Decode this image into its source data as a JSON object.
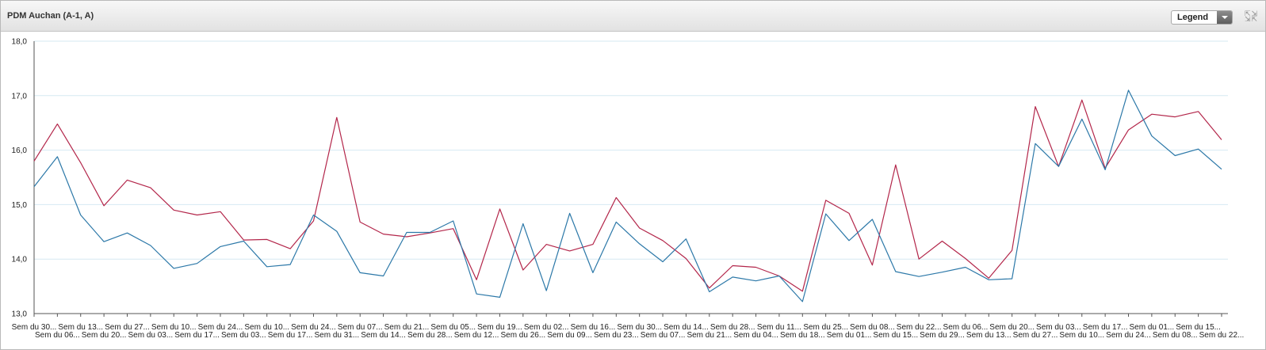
{
  "header": {
    "title": "PDM Auchan (A-1, A)",
    "legend_label": "Legend",
    "expand_icon": "expand-icon"
  },
  "colors": {
    "series_a": "#b3264a",
    "series_b": "#2c78a8",
    "grid": "#d6e9f2",
    "axis": "#555555"
  },
  "chart_data": {
    "type": "line",
    "title": "PDM Auchan (A-1, A)",
    "xlabel": "",
    "ylabel": "",
    "ylim": [
      13.0,
      18.0
    ],
    "yticks": [
      "13,0",
      "14,0",
      "15,0",
      "16,0",
      "17,0",
      "18,0"
    ],
    "ytick_values": [
      13.0,
      14.0,
      15.0,
      16.0,
      17.0,
      18.0
    ],
    "grid": true,
    "legend": "collapsed dropdown (top-right)",
    "categories": [
      "Sem du 30...",
      "Sem du 06...",
      "Sem du 13...",
      "Sem du 20...",
      "Sem du 27...",
      "Sem du 03...",
      "Sem du 10...",
      "Sem du 17...",
      "Sem du 24...",
      "Sem du 03...",
      "Sem du 10...",
      "Sem du 17...",
      "Sem du 24...",
      "Sem du 31...",
      "Sem du 07...",
      "Sem du 14...",
      "Sem du 21...",
      "Sem du 28...",
      "Sem du 05...",
      "Sem du 12...",
      "Sem du 19...",
      "Sem du 26...",
      "Sem du 02...",
      "Sem du 09...",
      "Sem du 16...",
      "Sem du 23...",
      "Sem du 30...",
      "Sem du 07...",
      "Sem du 14...",
      "Sem du 21...",
      "Sem du 28...",
      "Sem du 04...",
      "Sem du 11...",
      "Sem du 18...",
      "Sem du 25...",
      "Sem du 01...",
      "Sem du 08...",
      "Sem du 15...",
      "Sem du 22...",
      "Sem du 29...",
      "Sem du 06...",
      "Sem du 13...",
      "Sem du 20...",
      "Sem du 27...",
      "Sem du 03...",
      "Sem du 10...",
      "Sem du 17...",
      "Sem du 24...",
      "Sem du 01...",
      "Sem du 08...",
      "Sem du 15...",
      "Sem du 22..."
    ],
    "series": [
      {
        "color": "#b3264a",
        "values": [
          15.8,
          16.48,
          15.77,
          14.98,
          15.45,
          15.31,
          14.9,
          14.81,
          14.87,
          14.35,
          14.36,
          14.19,
          14.7,
          16.6,
          14.68,
          14.46,
          14.41,
          14.48,
          14.56,
          13.62,
          14.92,
          13.8,
          14.27,
          14.15,
          14.27,
          15.13,
          14.57,
          14.34,
          14.01,
          13.47,
          13.88,
          13.85,
          13.69,
          13.41,
          15.08,
          14.84,
          13.89,
          15.73,
          14.0,
          14.33,
          14.01,
          13.65,
          14.16,
          16.8,
          15.7,
          16.92,
          15.67,
          16.37,
          16.66,
          16.61,
          16.71,
          16.19
        ]
      },
      {
        "color": "#2c78a8",
        "values": [
          15.33,
          15.88,
          14.81,
          14.32,
          14.48,
          14.25,
          13.83,
          13.92,
          14.23,
          14.33,
          13.86,
          13.9,
          14.81,
          14.51,
          13.75,
          13.69,
          14.49,
          14.49,
          14.7,
          13.36,
          13.3,
          14.65,
          13.42,
          14.84,
          13.75,
          14.68,
          14.28,
          13.95,
          14.37,
          13.4,
          13.67,
          13.6,
          13.69,
          13.22,
          14.83,
          14.34,
          14.73,
          13.77,
          13.68,
          13.76,
          13.85,
          13.62,
          13.64,
          16.12,
          15.7,
          16.57,
          15.64,
          17.1,
          16.26,
          15.9,
          16.02,
          15.65
        ]
      }
    ]
  }
}
